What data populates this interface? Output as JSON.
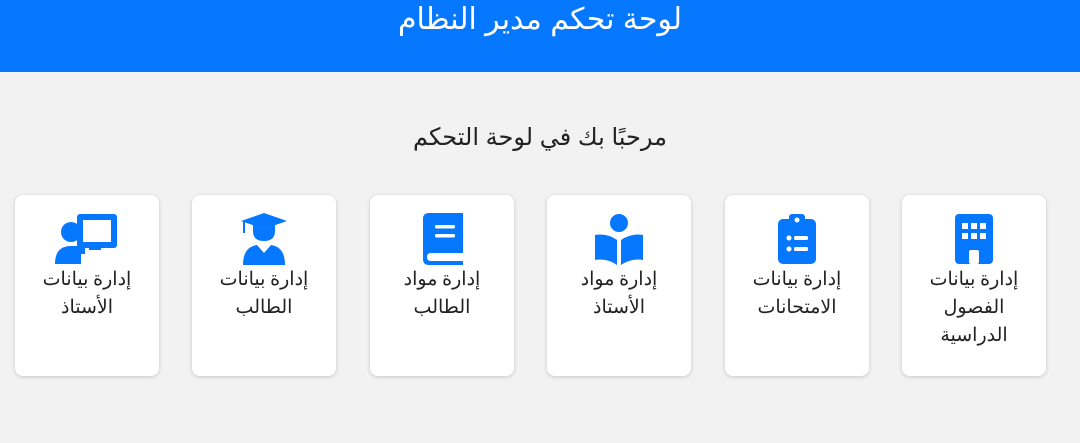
{
  "header": {
    "title": "لوحة تحكم مدير النظام",
    "color": "#0677ff"
  },
  "welcome": "مرحبًا بك في لوحة التحكم",
  "accent_color": "#0677ff",
  "cards": [
    {
      "label": "إدارة بيانات\nالفصول\nالدراسية",
      "icon": "building-icon"
    },
    {
      "label": "إدارة بيانات\nالامتحانات",
      "icon": "clipboard-list-icon"
    },
    {
      "label": "إدارة مواد\nالأستاذ",
      "icon": "book-reader-icon"
    },
    {
      "label": "إدارة مواد\nالطالب",
      "icon": "book-icon"
    },
    {
      "label": "إدارة بيانات\nالطالب",
      "icon": "graduate-icon"
    },
    {
      "label": "إدارة بيانات\nالأستاذ",
      "icon": "teacher-board-icon"
    }
  ]
}
